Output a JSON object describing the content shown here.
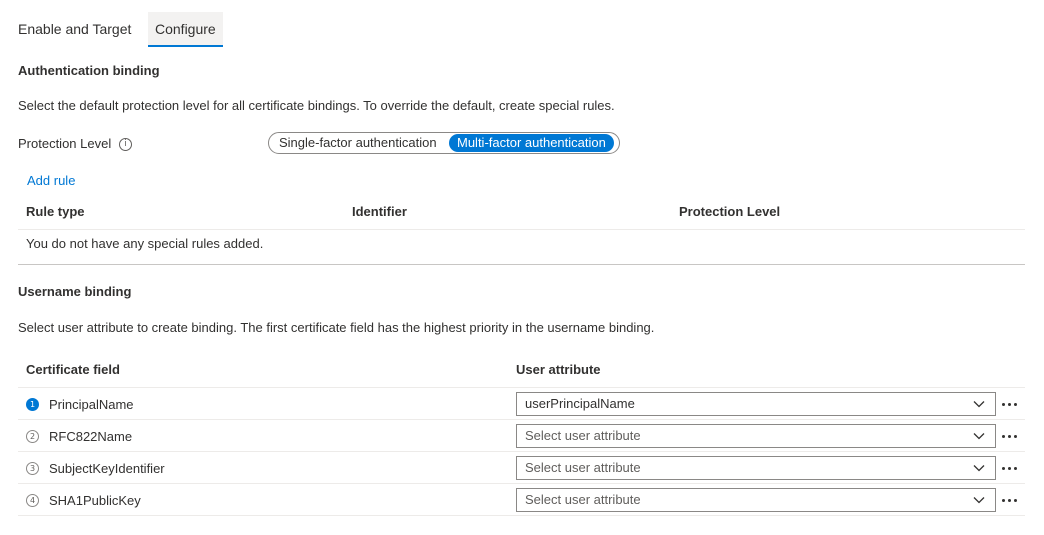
{
  "tabs": [
    {
      "label": "Enable and Target",
      "active": false
    },
    {
      "label": "Configure",
      "active": true
    }
  ],
  "auth_binding": {
    "title": "Authentication binding",
    "description": "Select the default protection level for all certificate bindings. To override the default, create special rules.",
    "protection_label": "Protection Level",
    "info_glyph": "i",
    "options": [
      "Single-factor authentication",
      "Multi-factor authentication"
    ],
    "selected_option": "Multi-factor authentication",
    "add_rule": "Add rule",
    "columns": [
      "Rule type",
      "Identifier",
      "Protection Level"
    ],
    "empty_message": "You do not have any special rules added."
  },
  "username_binding": {
    "title": "Username binding",
    "description": "Select user attribute to create binding. The first certificate field has the highest priority in the username binding.",
    "columns": [
      "Certificate field",
      "User attribute"
    ],
    "rows": [
      {
        "num": "1",
        "field": "PrincipalName",
        "attribute": "userPrincipalName",
        "placeholder": false
      },
      {
        "num": "2",
        "field": "RFC822Name",
        "attribute": "Select user attribute",
        "placeholder": true
      },
      {
        "num": "3",
        "field": "SubjectKeyIdentifier",
        "attribute": "Select user attribute",
        "placeholder": true
      },
      {
        "num": "4",
        "field": "SHA1PublicKey",
        "attribute": "Select user attribute",
        "placeholder": true
      }
    ]
  },
  "colors": {
    "accent": "#0078d4",
    "text": "#323130",
    "border": "#8a8886",
    "divider": "#edebe9"
  },
  "icons": [
    "info-icon",
    "chevron-down-icon",
    "more-icon",
    "step-number-icon"
  ]
}
